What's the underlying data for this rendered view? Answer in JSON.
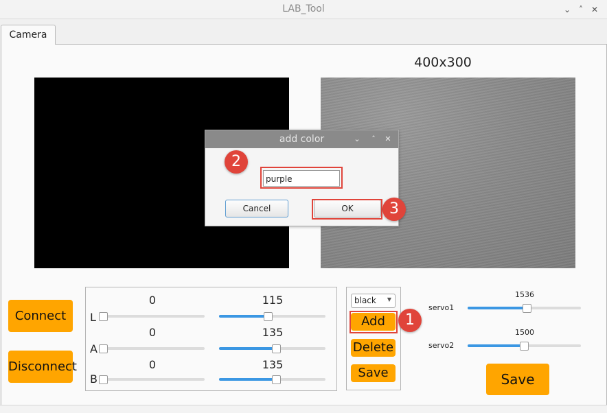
{
  "window": {
    "title": "LAB_Tool",
    "controls": [
      "⌄",
      "˄",
      "✕"
    ]
  },
  "tabs": [
    {
      "label": "Camera",
      "active": true
    }
  ],
  "camera": {
    "resolution_label": "400x300"
  },
  "buttons": {
    "connect": "Connect",
    "disconnect": "Disconnect",
    "save_main": "Save"
  },
  "lab": {
    "channels": [
      {
        "name": "L",
        "min": "0",
        "max": "115",
        "min_fraction": 0.0,
        "max_fraction": 0.45
      },
      {
        "name": "A",
        "min": "0",
        "max": "135",
        "min_fraction": 0.0,
        "max_fraction": 0.53
      },
      {
        "name": "B",
        "min": "0",
        "max": "135",
        "min_fraction": 0.0,
        "max_fraction": 0.53
      }
    ]
  },
  "color": {
    "selected": "black",
    "add": "Add",
    "delete": "Delete",
    "save": "Save"
  },
  "servos": [
    {
      "label": "servo1",
      "value": "1536",
      "fraction": 0.51
    },
    {
      "label": "servo2",
      "value": "1500",
      "fraction": 0.49
    }
  ],
  "dialog": {
    "title": "add color",
    "controls": [
      "⌄",
      "˄",
      "✕"
    ],
    "input_value": "purple",
    "cancel": "Cancel",
    "ok": "OK"
  },
  "steps": [
    "1",
    "2",
    "3"
  ],
  "colors": {
    "accent": "#ffa500",
    "annotation": "#e0443a",
    "slider_fill": "#3b97e3"
  }
}
